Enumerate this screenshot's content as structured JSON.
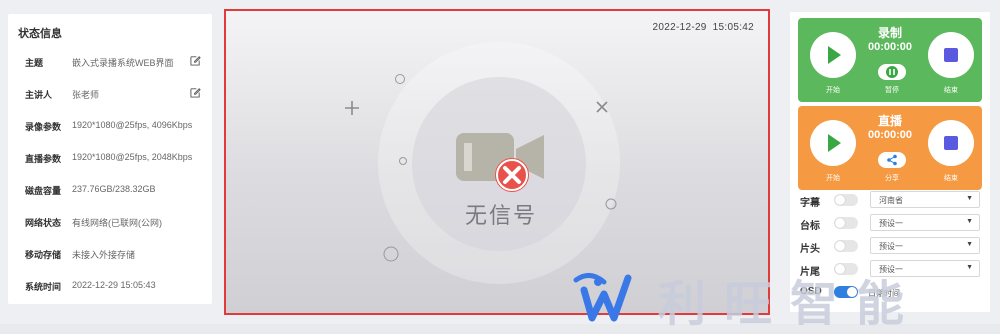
{
  "status_panel": {
    "title": "状态信息",
    "rows": [
      {
        "key": "主题",
        "value": "嵌入式录播系统WEB界面",
        "editable": true
      },
      {
        "key": "主讲人",
        "value": "张老师",
        "editable": true
      },
      {
        "key": "录像参数",
        "value": "1920*1080@25fps, 4096Kbps"
      },
      {
        "key": "直播参数",
        "value": "1920*1080@25fps, 2048Kbps"
      },
      {
        "key": "磁盘容量",
        "value": "237.76GB/238.32GB"
      },
      {
        "key": "网络状态",
        "value": "有线网络(已联网(公网)"
      },
      {
        "key": "移动存储",
        "value": "未接入外接存储"
      },
      {
        "key": "系统时间",
        "value": "2022-12-29 15:05:43"
      }
    ]
  },
  "video": {
    "date": "2022-12-29",
    "time": "15:05:42",
    "no_signal": "无信号"
  },
  "record_card": {
    "title": "录制",
    "time": "00:00:00",
    "start_label": "开始",
    "pause_label": "暂停",
    "stop_label": "结束",
    "color": "#5cb85c"
  },
  "live_card": {
    "title": "直播",
    "time": "00:00:00",
    "start_label": "开始",
    "share_label": "分享",
    "stop_label": "结束",
    "color": "#f59a42"
  },
  "controls": [
    {
      "key": "字幕",
      "on": false,
      "value": "河南省"
    },
    {
      "key": "台标",
      "on": false,
      "value": "预设一"
    },
    {
      "key": "片头",
      "on": false,
      "value": "预设一"
    },
    {
      "key": "片尾",
      "on": false,
      "value": "预设一"
    },
    {
      "key": "OSD",
      "on": true,
      "value": "日期时间"
    }
  ],
  "watermark": {
    "text": "利旺智能"
  },
  "colors": {
    "accent_blue": "#2f7fe0",
    "border_red": "#e03a3a"
  }
}
